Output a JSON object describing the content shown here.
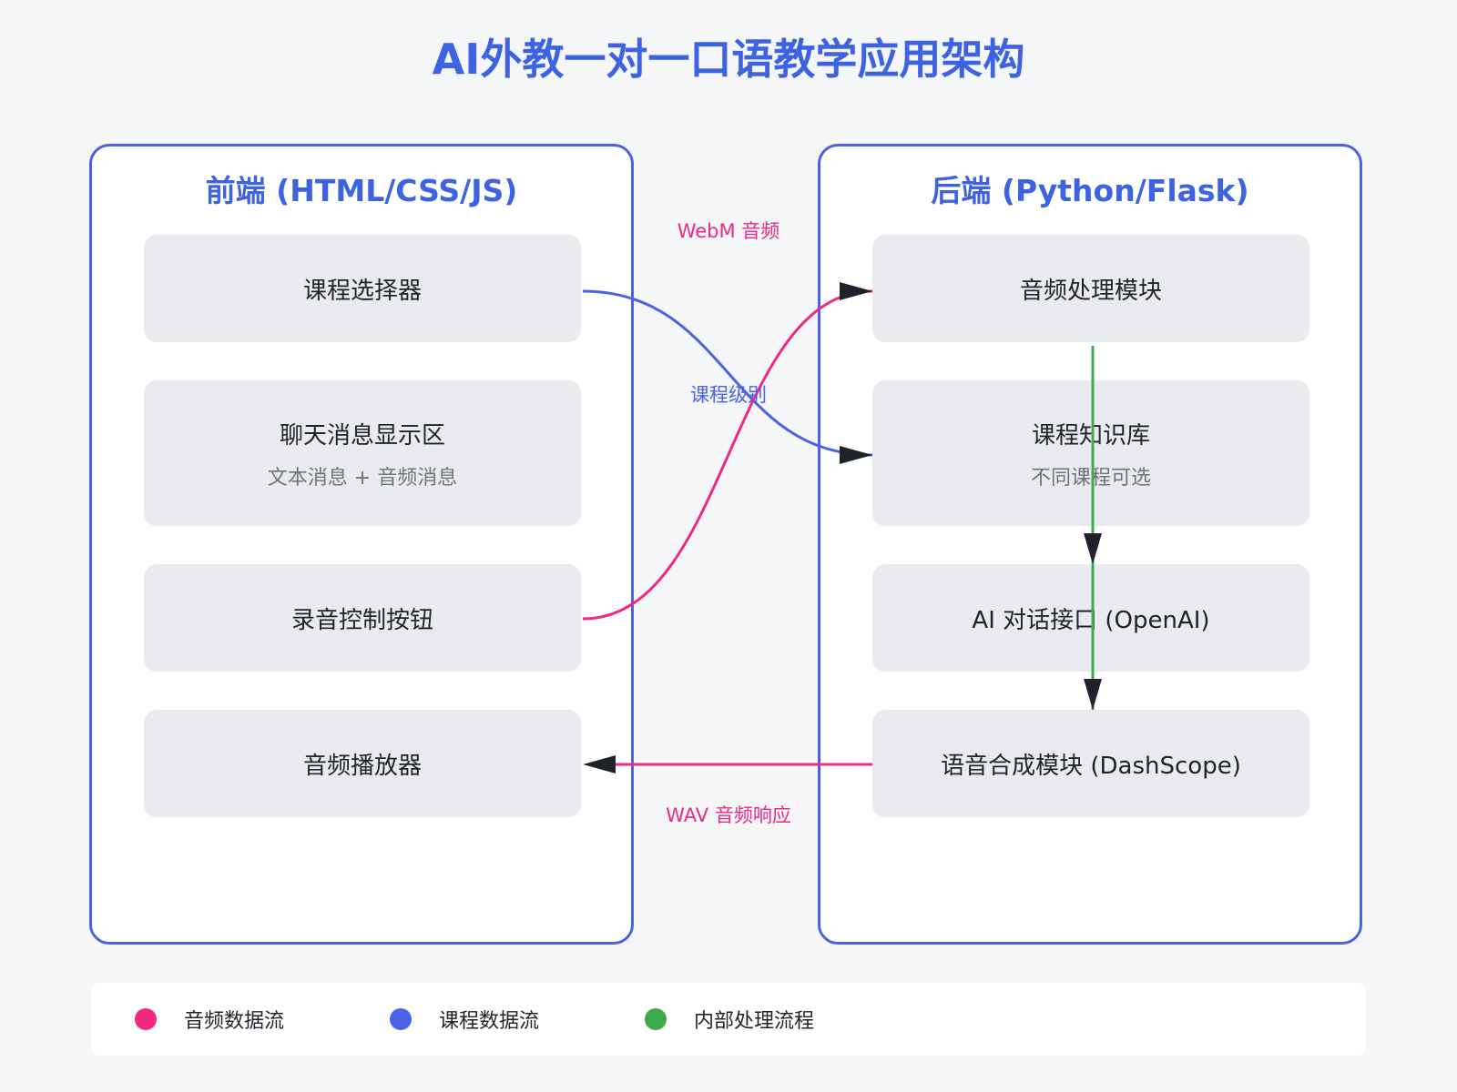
{
  "title": "AI外教一对一口语教学应用架构",
  "frontend": {
    "title": "前端 (HTML/CSS/JS)",
    "modules": [
      {
        "name": "课程选择器",
        "sub": ""
      },
      {
        "name": "聊天消息显示区",
        "sub": "文本消息 + 音频消息"
      },
      {
        "name": "录音控制按钮",
        "sub": ""
      },
      {
        "name": "音频播放器",
        "sub": ""
      }
    ]
  },
  "backend": {
    "title": "后端 (Python/Flask)",
    "modules": [
      {
        "name": "音频处理模块",
        "sub": ""
      },
      {
        "name": "课程知识库",
        "sub": "不同课程可选"
      },
      {
        "name": "AI 对话接口 (OpenAI)",
        "sub": ""
      },
      {
        "name": "语音合成模块 (DashScope)",
        "sub": ""
      }
    ]
  },
  "flows": {
    "webm": "WebM 音频",
    "course_level": "课程级别",
    "wav": "WAV 音频响应"
  },
  "legend": [
    {
      "label": "音频数据流",
      "color": "#ec2a85"
    },
    {
      "label": "课程数据流",
      "color": "#4a63e5"
    },
    {
      "label": "内部处理流程",
      "color": "#3fab4a"
    }
  ],
  "colors": {
    "audio": "#ec2a85",
    "course": "#4a63e5",
    "internal": "#3fab4a",
    "arrowhead": "#1f2329",
    "accent": "#3d63e3"
  }
}
